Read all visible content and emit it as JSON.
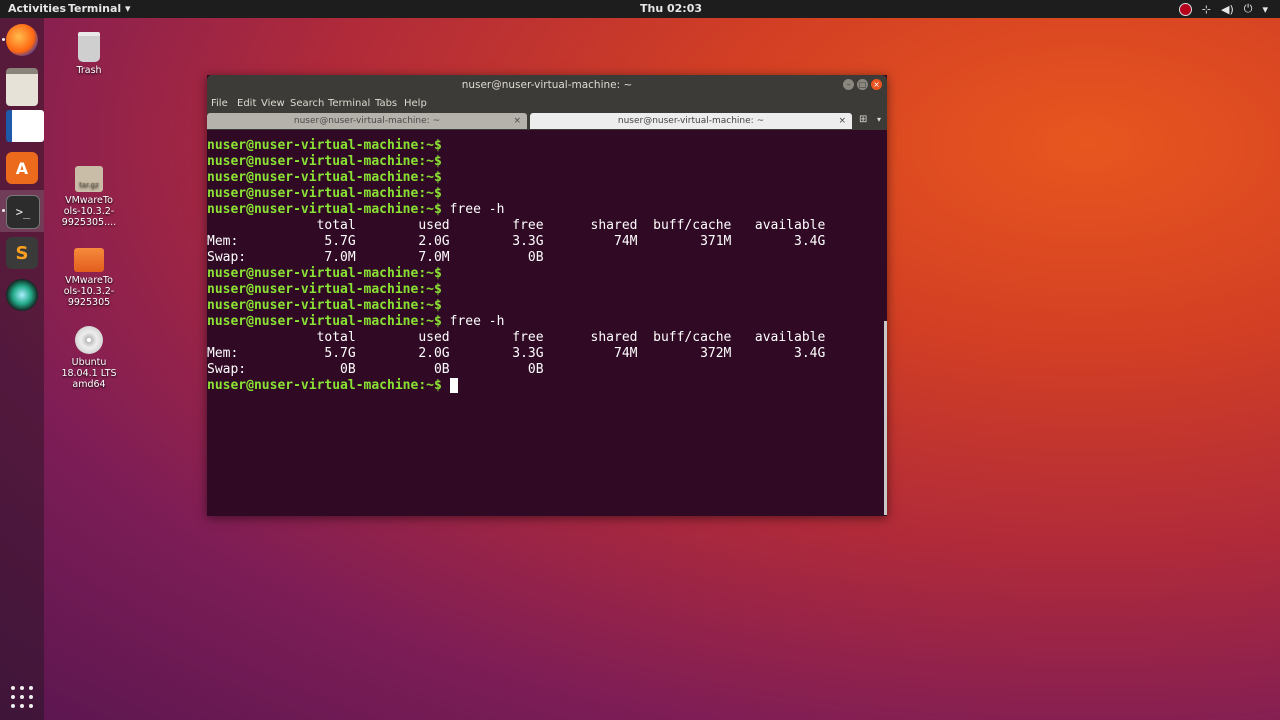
{
  "topbar": {
    "activities": "Activities",
    "app_menu": "Terminal ▾",
    "clock": "Thu 02:03",
    "tray": [
      "network-icon",
      "volume-icon",
      "power-icon"
    ]
  },
  "dock": {
    "apps": [
      "firefox-icon",
      "files-icon",
      "writer-icon",
      "software-icon",
      "terminal-icon",
      "sublime-icon",
      "vlc-icon"
    ],
    "show_apps": "show-apps-icon"
  },
  "desktop": {
    "trash": "Trash",
    "archive_badge": "tar.gz",
    "archive": "VMwareTo ols-10.3.2- 9925305....",
    "folder": "VMwareTo ols-10.3.2- 9925305",
    "dvd": "Ubuntu 18.04.1 LTS amd64"
  },
  "window": {
    "title": "nuser@nuser-virtual-machine: ~",
    "menu": [
      "File",
      "Edit",
      "View",
      "Search",
      "Terminal",
      "Tabs",
      "Help"
    ],
    "tabs": [
      {
        "label": "nuser@nuser-virtual-machine: ~",
        "close": "×"
      },
      {
        "label": "nuser@nuser-virtual-machine: ~",
        "close": "×"
      }
    ]
  },
  "terminal": {
    "prompt": "nuser@nuser-virtual-machine:~$",
    "lines": [
      {
        "type": "prompt",
        "cmd": ""
      },
      {
        "type": "prompt",
        "cmd": ""
      },
      {
        "type": "prompt",
        "cmd": ""
      },
      {
        "type": "prompt",
        "cmd": ""
      },
      {
        "type": "prompt",
        "cmd": " free -h"
      },
      {
        "type": "out",
        "text": "              total        used        free      shared  buff/cache   available"
      },
      {
        "type": "out",
        "text": "Mem:           5.7G        2.0G        3.3G         74M        371M        3.4G"
      },
      {
        "type": "out",
        "text": "Swap:          7.0M        7.0M          0B"
      },
      {
        "type": "prompt",
        "cmd": ""
      },
      {
        "type": "prompt",
        "cmd": ""
      },
      {
        "type": "prompt",
        "cmd": ""
      },
      {
        "type": "prompt",
        "cmd": " free -h"
      },
      {
        "type": "out",
        "text": "              total        used        free      shared  buff/cache   available"
      },
      {
        "type": "out",
        "text": "Mem:           5.7G        2.0G        3.3G         74M        372M        3.4G"
      },
      {
        "type": "out",
        "text": "Swap:            0B          0B          0B"
      },
      {
        "type": "prompt",
        "cmd": " ",
        "cursor": true
      }
    ]
  }
}
